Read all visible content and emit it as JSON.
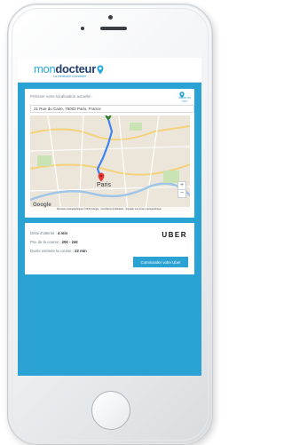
{
  "app": {
    "logo_mon": "mon",
    "logo_docteur": "docteur",
    "tagline": "La médecine connectée"
  },
  "location": {
    "label": "Préciser votre localisation actuelle :",
    "pin_text": "Autour de moi",
    "address_value": "21 Rue du Caire, 75002 Paris, France",
    "map_city_label": "Paris",
    "map_attribution": "Données cartographiques ©2015 Google · Conditions d'utilisation · Signaler une erreur cartographique",
    "google_label": "Google"
  },
  "ride": {
    "wait_label": "Délai d'attente :",
    "wait_value": "4 min",
    "price_label": "Prix de la course :",
    "price_value": "20€ - 24€",
    "duration_label": "Durée estimée la course :",
    "duration_value": "22 min",
    "provider": "UBER",
    "order_button": "Commander votre Uber"
  },
  "colors": {
    "accent": "#2aa3d4",
    "brand_dark": "#223e6a",
    "route": "#3b82f6",
    "destination_pin": "#e53935",
    "origin_pin": "#2e7d32"
  },
  "icons": {
    "location": "map-pin-icon",
    "zoom_in": "plus-icon",
    "zoom_out": "minus-icon"
  }
}
